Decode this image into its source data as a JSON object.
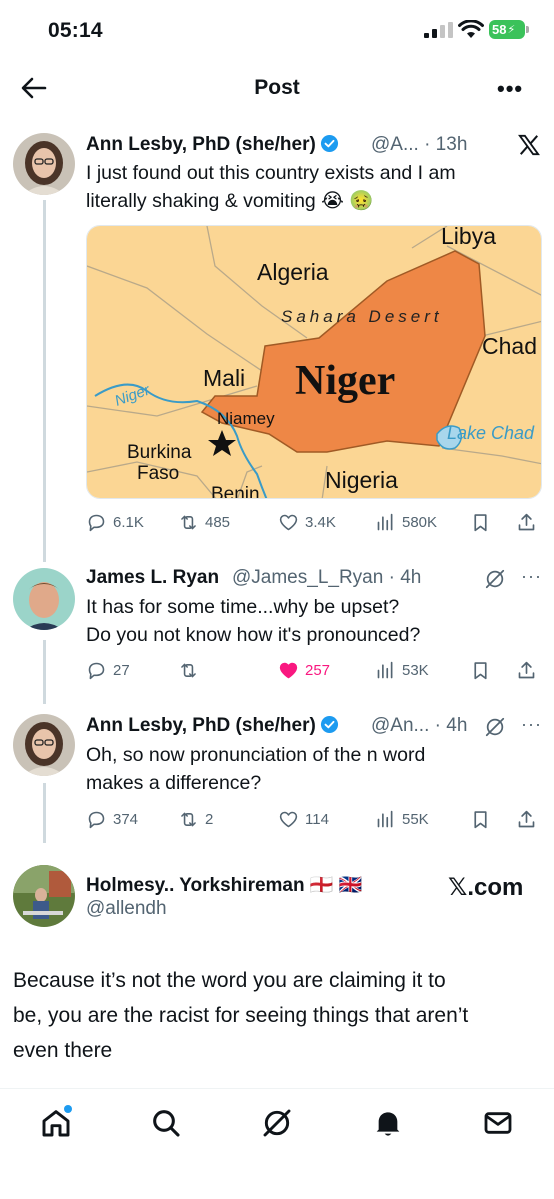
{
  "status_bar": {
    "time": "05:14",
    "battery": "58"
  },
  "header": {
    "title": "Post"
  },
  "main_post": {
    "name": "Ann Lesby, PhD (she/her)",
    "handle": "@A...",
    "time": "· 13h",
    "text_line1": "I just found out this country exists and I am",
    "text_line2": "literally shaking & vomiting 😭 🤢",
    "map": {
      "labels": {
        "libya": "Libya",
        "algeria": "Algeria",
        "sahara": "Sahara Desert",
        "chad": "Chad",
        "mali": "Mali",
        "niger": "Niger",
        "niger_river": "Niger",
        "niamey": "Niamey",
        "lake_chad": "Lake Chad",
        "burkina": "Burkina",
        "faso": "Faso",
        "nigeria": "Nigeria",
        "benin": "Benin"
      },
      "colors": {
        "niger": "#ee8746",
        "land": "#fbd694",
        "water": "#3a9bc7"
      }
    },
    "stats": {
      "replies": "6.1K",
      "reposts": "485",
      "likes": "3.4K",
      "views": "580K"
    }
  },
  "reply1": {
    "name": "James L. Ryan",
    "handle": "@James_L_Ryan",
    "time": "· 4h",
    "text_line1": "It has for some time...why be upset?",
    "text_line2": "Do you not know how it's pronounced?",
    "stats": {
      "replies": "27",
      "reposts": "",
      "likes": "257",
      "views": "53K"
    }
  },
  "reply2": {
    "name": "Ann Lesby, PhD (she/her)",
    "handle": "@An...",
    "time": "· 4h",
    "text_line1": "Oh, so now pronunciation of the n word",
    "text_line2": "makes a difference?",
    "stats": {
      "replies": "374",
      "reposts": "2",
      "likes": "114",
      "views": "55K"
    }
  },
  "reply3": {
    "name": "Holmesy.. Yorkshireman 🏴󠁧󠁢󠁥󠁮󠁧󠁿 🇬🇧",
    "handle": "@allendh",
    "watermark": "𝕏.com",
    "text_line1": "Because it’s not the word you are claiming it to",
    "text_line2": "be, you are the racist for seeing things that aren’t",
    "text_line3": "even there"
  },
  "icons": [
    "back-arrow-icon",
    "more-icon",
    "verified-icon",
    "x-logo-icon",
    "reply-icon",
    "repost-icon",
    "like-icon",
    "views-icon",
    "bookmark-icon",
    "share-icon",
    "grok-icon",
    "home-icon",
    "search-icon",
    "notifications-icon",
    "messages-icon"
  ],
  "accent_color": "#1d9bf0",
  "like_color": "#f91880"
}
